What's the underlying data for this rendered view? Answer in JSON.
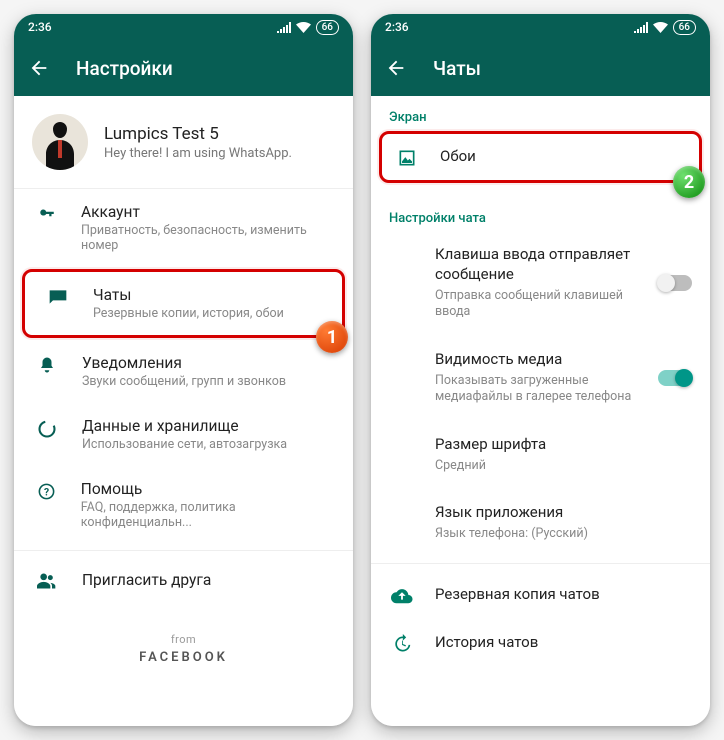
{
  "status": {
    "time": "2:36",
    "battery": "66"
  },
  "callouts": {
    "one": "1",
    "two": "2"
  },
  "screen1": {
    "title": "Настройки",
    "profile": {
      "name": "Lumpics Test 5",
      "status": "Hey there! I am using WhatsApp."
    },
    "items": {
      "account": {
        "title": "Аккаунт",
        "sub": "Приватность, безопасность, изменить номер"
      },
      "chats": {
        "title": "Чаты",
        "sub": "Резервные копии, история, обои"
      },
      "notif": {
        "title": "Уведомления",
        "sub": "Звуки сообщений, групп и звонков"
      },
      "data": {
        "title": "Данные и хранилище",
        "sub": "Использование сети, автозагрузка"
      },
      "help": {
        "title": "Помощь",
        "sub": "FAQ, поддержка, политика конфиденциальн..."
      },
      "invite": {
        "title": "Пригласить друга"
      }
    },
    "footer": {
      "from": "from",
      "brand": "FACEBOOK"
    }
  },
  "screen2": {
    "title": "Чаты",
    "section_screen": "Экран",
    "wallpaper": "Обои",
    "section_chat": "Настройки чата",
    "enter_send": {
      "title": "Клавиша ввода отправляет сообщение",
      "sub": "Отправка сообщений клавишей ввода"
    },
    "media_vis": {
      "title": "Видимость медиа",
      "sub": "Показывать загруженные медиафайлы в галерее телефона"
    },
    "font_size": {
      "title": "Размер шрифта",
      "sub": "Средний"
    },
    "lang": {
      "title": "Язык приложения",
      "sub": "Язык телефона: (Русский)"
    },
    "backup": "Резервная копия чатов",
    "history": "История чатов"
  }
}
